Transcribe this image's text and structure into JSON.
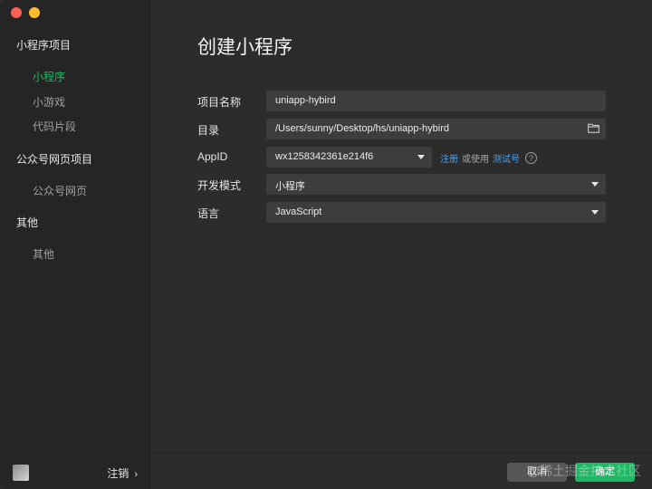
{
  "sidebar": {
    "groups": [
      {
        "title": "小程序项目",
        "items": [
          "小程序",
          "小游戏",
          "代码片段"
        ]
      },
      {
        "title": "公众号网页项目",
        "items": [
          "公众号网页"
        ]
      },
      {
        "title": "其他",
        "items": [
          "其他"
        ]
      }
    ],
    "active_item": "小程序",
    "footer": {
      "logout_label": "注销",
      "chevron": "›"
    }
  },
  "main": {
    "title": "创建小程序",
    "form": {
      "project_name": {
        "label": "项目名称",
        "value": "uniapp-hybird"
      },
      "directory": {
        "label": "目录",
        "value": "/Users/sunny/Desktop/hs/uniapp-hybird",
        "icon": "folder-icon"
      },
      "appid": {
        "label": "AppID",
        "value": "wx1258342361e214f6",
        "register_link": "注册",
        "or_use": "或使用",
        "test_link": "测试号",
        "help": "?"
      },
      "dev_mode": {
        "label": "开发模式",
        "value": "小程序"
      },
      "language": {
        "label": "语言",
        "value": "JavaScript"
      }
    },
    "buttons": {
      "cancel": "取消",
      "confirm": "确定"
    }
  },
  "watermark": "@稀土掘金技术社区",
  "colors": {
    "accent": "#1fb865",
    "link": "#4aa3f0",
    "sidebar_bg": "#252525",
    "main_bg": "#2c2c2c",
    "field_bg": "#3d3d3d"
  }
}
